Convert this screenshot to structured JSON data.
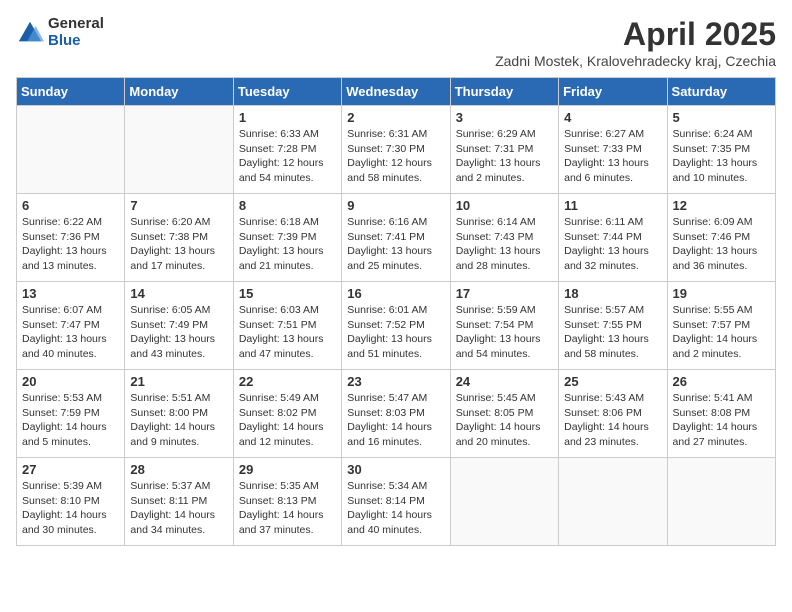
{
  "header": {
    "logo_general": "General",
    "logo_blue": "Blue",
    "month_title": "April 2025",
    "location": "Zadni Mostek, Kralovehradecky kraj, Czechia"
  },
  "weekdays": [
    "Sunday",
    "Monday",
    "Tuesday",
    "Wednesday",
    "Thursday",
    "Friday",
    "Saturday"
  ],
  "weeks": [
    [
      {
        "day": "",
        "empty": true
      },
      {
        "day": "",
        "empty": true
      },
      {
        "day": "1",
        "sunrise": "6:33 AM",
        "sunset": "7:28 PM",
        "daylight": "12 hours and 54 minutes."
      },
      {
        "day": "2",
        "sunrise": "6:31 AM",
        "sunset": "7:30 PM",
        "daylight": "12 hours and 58 minutes."
      },
      {
        "day": "3",
        "sunrise": "6:29 AM",
        "sunset": "7:31 PM",
        "daylight": "13 hours and 2 minutes."
      },
      {
        "day": "4",
        "sunrise": "6:27 AM",
        "sunset": "7:33 PM",
        "daylight": "13 hours and 6 minutes."
      },
      {
        "day": "5",
        "sunrise": "6:24 AM",
        "sunset": "7:35 PM",
        "daylight": "13 hours and 10 minutes."
      }
    ],
    [
      {
        "day": "6",
        "sunrise": "6:22 AM",
        "sunset": "7:36 PM",
        "daylight": "13 hours and 13 minutes."
      },
      {
        "day": "7",
        "sunrise": "6:20 AM",
        "sunset": "7:38 PM",
        "daylight": "13 hours and 17 minutes."
      },
      {
        "day": "8",
        "sunrise": "6:18 AM",
        "sunset": "7:39 PM",
        "daylight": "13 hours and 21 minutes."
      },
      {
        "day": "9",
        "sunrise": "6:16 AM",
        "sunset": "7:41 PM",
        "daylight": "13 hours and 25 minutes."
      },
      {
        "day": "10",
        "sunrise": "6:14 AM",
        "sunset": "7:43 PM",
        "daylight": "13 hours and 28 minutes."
      },
      {
        "day": "11",
        "sunrise": "6:11 AM",
        "sunset": "7:44 PM",
        "daylight": "13 hours and 32 minutes."
      },
      {
        "day": "12",
        "sunrise": "6:09 AM",
        "sunset": "7:46 PM",
        "daylight": "13 hours and 36 minutes."
      }
    ],
    [
      {
        "day": "13",
        "sunrise": "6:07 AM",
        "sunset": "7:47 PM",
        "daylight": "13 hours and 40 minutes."
      },
      {
        "day": "14",
        "sunrise": "6:05 AM",
        "sunset": "7:49 PM",
        "daylight": "13 hours and 43 minutes."
      },
      {
        "day": "15",
        "sunrise": "6:03 AM",
        "sunset": "7:51 PM",
        "daylight": "13 hours and 47 minutes."
      },
      {
        "day": "16",
        "sunrise": "6:01 AM",
        "sunset": "7:52 PM",
        "daylight": "13 hours and 51 minutes."
      },
      {
        "day": "17",
        "sunrise": "5:59 AM",
        "sunset": "7:54 PM",
        "daylight": "13 hours and 54 minutes."
      },
      {
        "day": "18",
        "sunrise": "5:57 AM",
        "sunset": "7:55 PM",
        "daylight": "13 hours and 58 minutes."
      },
      {
        "day": "19",
        "sunrise": "5:55 AM",
        "sunset": "7:57 PM",
        "daylight": "14 hours and 2 minutes."
      }
    ],
    [
      {
        "day": "20",
        "sunrise": "5:53 AM",
        "sunset": "7:59 PM",
        "daylight": "14 hours and 5 minutes."
      },
      {
        "day": "21",
        "sunrise": "5:51 AM",
        "sunset": "8:00 PM",
        "daylight": "14 hours and 9 minutes."
      },
      {
        "day": "22",
        "sunrise": "5:49 AM",
        "sunset": "8:02 PM",
        "daylight": "14 hours and 12 minutes."
      },
      {
        "day": "23",
        "sunrise": "5:47 AM",
        "sunset": "8:03 PM",
        "daylight": "14 hours and 16 minutes."
      },
      {
        "day": "24",
        "sunrise": "5:45 AM",
        "sunset": "8:05 PM",
        "daylight": "14 hours and 20 minutes."
      },
      {
        "day": "25",
        "sunrise": "5:43 AM",
        "sunset": "8:06 PM",
        "daylight": "14 hours and 23 minutes."
      },
      {
        "day": "26",
        "sunrise": "5:41 AM",
        "sunset": "8:08 PM",
        "daylight": "14 hours and 27 minutes."
      }
    ],
    [
      {
        "day": "27",
        "sunrise": "5:39 AM",
        "sunset": "8:10 PM",
        "daylight": "14 hours and 30 minutes."
      },
      {
        "day": "28",
        "sunrise": "5:37 AM",
        "sunset": "8:11 PM",
        "daylight": "14 hours and 34 minutes."
      },
      {
        "day": "29",
        "sunrise": "5:35 AM",
        "sunset": "8:13 PM",
        "daylight": "14 hours and 37 minutes."
      },
      {
        "day": "30",
        "sunrise": "5:34 AM",
        "sunset": "8:14 PM",
        "daylight": "14 hours and 40 minutes."
      },
      {
        "day": "",
        "empty": true
      },
      {
        "day": "",
        "empty": true
      },
      {
        "day": "",
        "empty": true
      }
    ]
  ]
}
